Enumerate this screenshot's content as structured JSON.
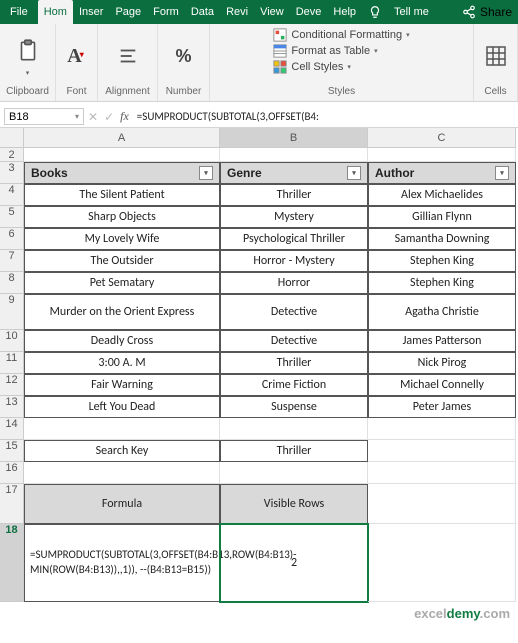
{
  "menu": {
    "file": "File",
    "items": [
      "Hom",
      "Inser",
      "Page",
      "Form",
      "Data",
      "Revi",
      "View",
      "Deve",
      "Help"
    ],
    "tellme": "Tell me",
    "share": "Share"
  },
  "ribbon": {
    "clipboard": "Clipboard",
    "font": "Font",
    "alignment": "Alignment",
    "number": "Number",
    "styles": "Styles",
    "cells": "Cells",
    "cond_format": "Conditional Formatting",
    "format_table": "Format as Table",
    "cell_styles": "Cell Styles",
    "percent": "%"
  },
  "namebox": "B18",
  "formula_bar": "=SUMPRODUCT(SUBTOTAL(3,OFFSET(B4:",
  "columns": [
    "A",
    "B",
    "C"
  ],
  "table": {
    "headers": [
      "Books",
      "Genre",
      "Author"
    ],
    "rows": [
      [
        "The Silent Patient",
        "Thriller",
        "Alex Michaelides"
      ],
      [
        "Sharp Objects",
        "Mystery",
        "Gillian Flynn"
      ],
      [
        "My Lovely Wife",
        "Psychological Thriller",
        "Samantha Downing"
      ],
      [
        "The Outsider",
        "Horror - Mystery",
        "Stephen King"
      ],
      [
        "Pet Sematary",
        "Horror",
        "Stephen King"
      ],
      [
        "Murder on the Orient Express",
        "Detective",
        "Agatha Christie"
      ],
      [
        "Deadly Cross",
        "Detective",
        "James Patterson"
      ],
      [
        "3:00 A. M",
        "Thriller",
        "Nick Pirog"
      ],
      [
        "Fair Warning",
        "Crime Fiction",
        "Michael Connelly"
      ],
      [
        "Left You Dead",
        "Suspense",
        "Peter James"
      ]
    ]
  },
  "search_key_label": "Search Key",
  "search_key_value": "Thriller",
  "formula_label": "Formula",
  "visible_rows_label": "Visible Rows",
  "formula_text": "=SUMPRODUCT(SUBTOTAL(3,OFFSET(B4:B13,ROW(B4:B13)-MIN(ROW(B4:B13)),,1)), --(B4:B13=B15))",
  "visible_rows_value": "2",
  "row_numbers": [
    "2",
    "3",
    "4",
    "5",
    "6",
    "7",
    "8",
    "9",
    "10",
    "11",
    "12",
    "13",
    "14",
    "15",
    "16",
    "17",
    "18"
  ],
  "watermark_a": "excel",
  "watermark_b": "demy",
  "watermark_c": ".com"
}
